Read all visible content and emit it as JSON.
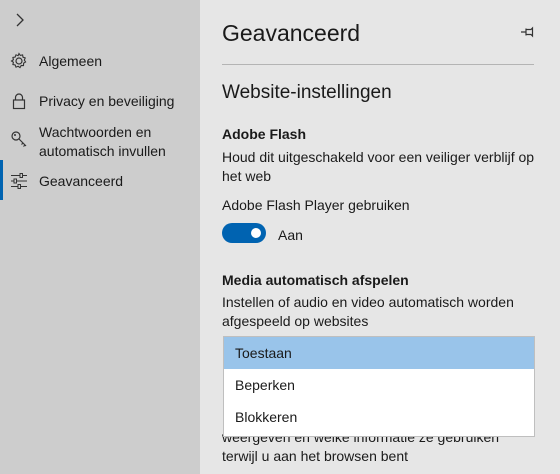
{
  "sidebar": {
    "items": [
      {
        "label": "Algemeen",
        "icon": "gear-icon"
      },
      {
        "label": "Privacy en beveiliging",
        "icon": "lock-icon"
      },
      {
        "label": "Wachtwoorden en automatisch invullen",
        "icon": "key-icon"
      },
      {
        "label": "Geavanceerd",
        "icon": "sliders-icon",
        "active": true
      }
    ]
  },
  "panel": {
    "title": "Geavanceerd",
    "section_title": "Website-instellingen",
    "flash": {
      "heading": "Adobe Flash",
      "description": "Houd dit uitgeschakeld voor een veiliger verblijf op het web",
      "toggle_caption": "Adobe Flash Player gebruiken",
      "toggle_state": "Aan",
      "toggle_on": true
    },
    "media": {
      "heading": "Media automatisch afspelen",
      "description": "Instellen of audio en video automatisch worden afgespeeld op websites",
      "options": [
        "Toestaan",
        "Beperken",
        "Blokkeren"
      ],
      "selected": "Toestaan"
    },
    "partial_text_1": "weergeven en welke informatie ze gebruiken",
    "partial_text_2": "terwijl u aan het browsen bent"
  },
  "colors": {
    "accent": "#0063b1",
    "selected_option": "#99c4ea",
    "sidebar_bg": "#cdcdcd",
    "panel_bg": "#e6e6e6"
  }
}
